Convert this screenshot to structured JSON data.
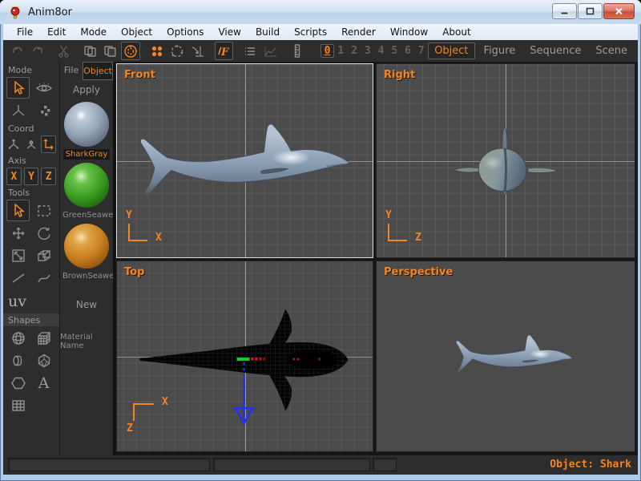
{
  "window": {
    "title": "Anim8or"
  },
  "menu": {
    "items": [
      "File",
      "Edit",
      "Mode",
      "Object",
      "Options",
      "View",
      "Build",
      "Scripts",
      "Render",
      "Window",
      "About"
    ]
  },
  "toolbar": {
    "frames": [
      "0",
      "1",
      "2",
      "3",
      "4",
      "5",
      "6",
      "7"
    ],
    "active_frame": "0",
    "modes": [
      "Object",
      "Figure",
      "Sequence",
      "Scene"
    ],
    "active_mode": "Object"
  },
  "sidebar": {
    "mode_label": "Mode",
    "coord_label": "Coord",
    "axis_label": "Axis",
    "tools_label": "Tools",
    "shapes_label": "Shapes",
    "uv_label": "uv",
    "axis_x": "X",
    "axis_y": "Y",
    "axis_z": "Z",
    "text_tool_label": "A"
  },
  "materials": {
    "tab_file": "File",
    "tab_object": "Object",
    "apply_label": "Apply",
    "new_label": "New",
    "name_label": "Material Name",
    "items": [
      {
        "name": "SharkGray",
        "color": "#97a5b8",
        "selected": true
      },
      {
        "name": "GreenSeaweed",
        "color": "#3a9e22",
        "selected": false
      },
      {
        "name": "BrownSeaweed",
        "color": "#c97f1e",
        "selected": false
      }
    ]
  },
  "viewports": {
    "front": {
      "label": "Front",
      "axis_up": "Y",
      "axis_right": "X"
    },
    "right": {
      "label": "Right",
      "axis_up": "Y",
      "axis_right": "Z"
    },
    "top": {
      "label": "Top",
      "axis_right": "X",
      "axis_down": "Z"
    },
    "perspective": {
      "label": "Perspective"
    }
  },
  "statusbar": {
    "object_label": "Object: Shark"
  },
  "colors": {
    "accent": "#f28522",
    "viewport_bg": "#4b4b4b",
    "grid_line": "#5a5a5a",
    "panel_bg": "#2d2d2d",
    "shark_body": "#93a3b8",
    "selection_green": "#1ecc1e",
    "normal_blue": "#2233ee",
    "marker_red": "#cc2222"
  }
}
